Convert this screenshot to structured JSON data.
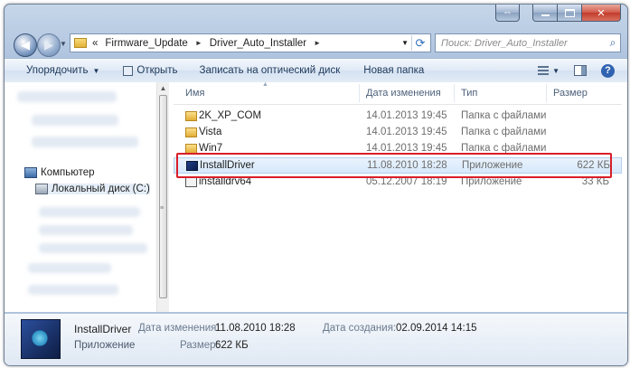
{
  "window": {
    "caption": {
      "restore": "⇔",
      "minimize": "",
      "maximize": "",
      "close": "✕"
    }
  },
  "address": {
    "overflow": "«",
    "crumbs": [
      "Firmware_Update",
      "Driver_Auto_Installer"
    ],
    "separator": "►"
  },
  "search": {
    "placeholder": "Поиск: Driver_Auto_Installer"
  },
  "toolbar": {
    "organize": "Упорядочить",
    "open": "Открыть",
    "burn": "Записать на оптический диск",
    "new_folder": "Новая папка",
    "help": "?"
  },
  "navpane": {
    "items": [
      {
        "label": "Компьютер",
        "icon": "computer-icon"
      },
      {
        "label": "Локальный диск (C:)",
        "icon": "drive-icon"
      }
    ]
  },
  "columns": {
    "name": "Имя",
    "date": "Дата изменения",
    "type": "Тип",
    "size": "Размер"
  },
  "files": [
    {
      "name": "2K_XP_COM",
      "date": "14.01.2013 19:45",
      "type": "Папка с файлами",
      "size": "",
      "icon": "folder-icon"
    },
    {
      "name": "Vista",
      "date": "14.01.2013 19:45",
      "type": "Папка с файлами",
      "size": "",
      "icon": "folder-icon"
    },
    {
      "name": "Win7",
      "date": "14.01.2013 19:45",
      "type": "Папка с файлами",
      "size": "",
      "icon": "folder-icon"
    },
    {
      "name": "InstallDriver",
      "date": "11.08.2010 18:28",
      "type": "Приложение",
      "size": "622 КБ",
      "icon": "application-icon",
      "selected": true
    },
    {
      "name": "installdrv64",
      "date": "05.12.2007 18:19",
      "type": "Приложение",
      "size": "33 КБ",
      "icon": "application-icon"
    }
  ],
  "highlight_color": "#d81e2a",
  "details": {
    "name": "InstallDriver",
    "type": "Приложение",
    "modified_label": "Дата изменения:",
    "modified_value": "11.08.2010 18:28",
    "size_label": "Размер:",
    "size_value": "622 КБ",
    "created_label": "Дата создания:",
    "created_value": "02.09.2014 14:15"
  }
}
